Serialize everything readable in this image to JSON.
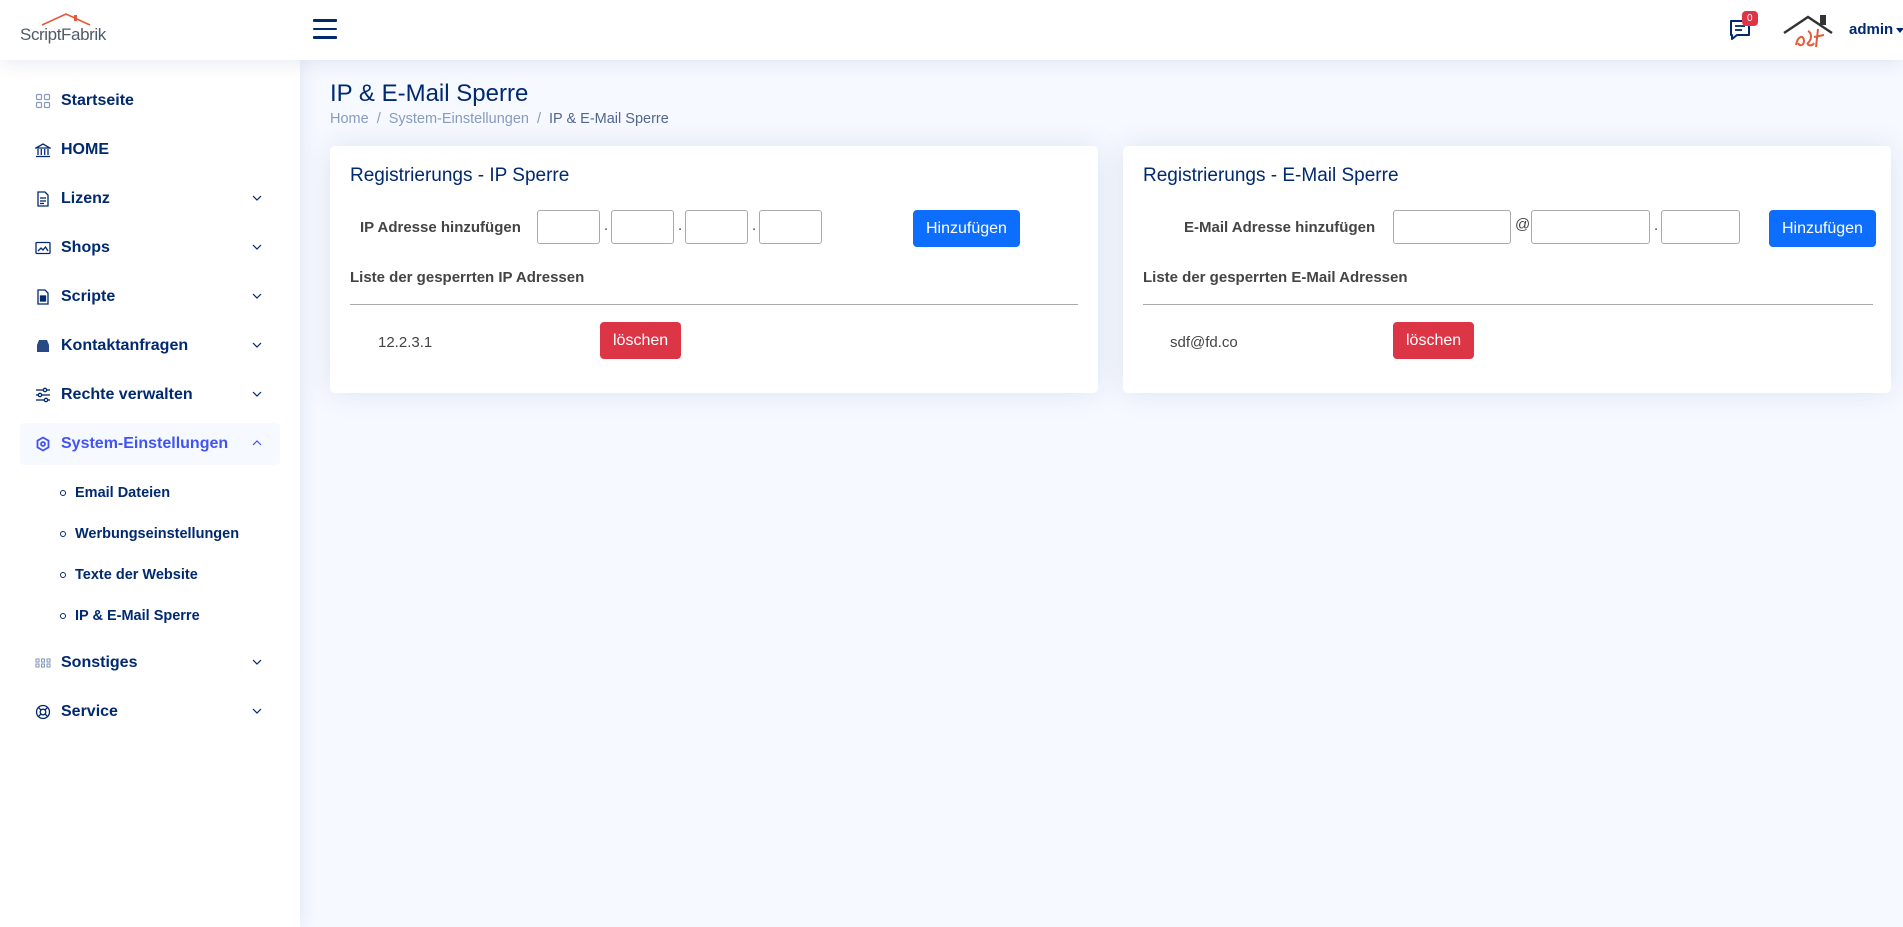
{
  "header": {
    "logo_text": "ScriptFabrik",
    "notifications_count": "0",
    "user_name": "admin"
  },
  "sidebar": {
    "items": [
      {
        "label": "Startseite",
        "icon": "grid-icon"
      },
      {
        "label": "HOME",
        "icon": "bank-icon"
      },
      {
        "label": "Lizenz",
        "icon": "document-icon"
      },
      {
        "label": "Shops",
        "icon": "image-icon"
      },
      {
        "label": "Scripte",
        "icon": "file-icon"
      },
      {
        "label": "Kontaktanfragen",
        "icon": "inbox-icon"
      },
      {
        "label": "Rechte verwalten",
        "icon": "sliders-icon"
      },
      {
        "label": "System-Einstellungen",
        "icon": "gear-icon"
      },
      {
        "label": "Sonstiges",
        "icon": "apps-icon"
      },
      {
        "label": "Service",
        "icon": "lifebuoy-icon"
      }
    ],
    "submenu": [
      {
        "label": "Email Dateien"
      },
      {
        "label": "Werbungseinstellungen"
      },
      {
        "label": "Texte der Website"
      },
      {
        "label": "IP & E-Mail Sperre"
      }
    ]
  },
  "page": {
    "title": "IP & E-Mail Sperre",
    "breadcrumb": [
      "Home",
      "System-Einstellungen",
      "IP & E-Mail Sperre"
    ],
    "breadcrumb_separator": "/"
  },
  "ip_card": {
    "title": "Registrierungs - IP Sperre",
    "form_label": "IP Adresse hinzufügen",
    "dot": ".",
    "add_label": "Hinzufügen",
    "list_title": "Liste der gesperrten IP Adressen",
    "entries": [
      {
        "value": "12.2.3.1",
        "delete_label": "löschen"
      }
    ]
  },
  "mail_card": {
    "title": "Registrierungs - E-Mail Sperre",
    "form_label": "E-Mail Adresse hinzufügen",
    "at": "@",
    "dot": ".",
    "add_label": "Hinzufügen",
    "list_title": "Liste der gesperrten E-Mail Adressen",
    "entries": [
      {
        "value": "sdf@fd.co",
        "delete_label": "löschen"
      }
    ]
  },
  "colors": {
    "primary": "#0d6efd",
    "danger": "#dc3545",
    "nav_text": "#012970",
    "nav_active": "#4154f1",
    "background": "#f6f9ff"
  }
}
